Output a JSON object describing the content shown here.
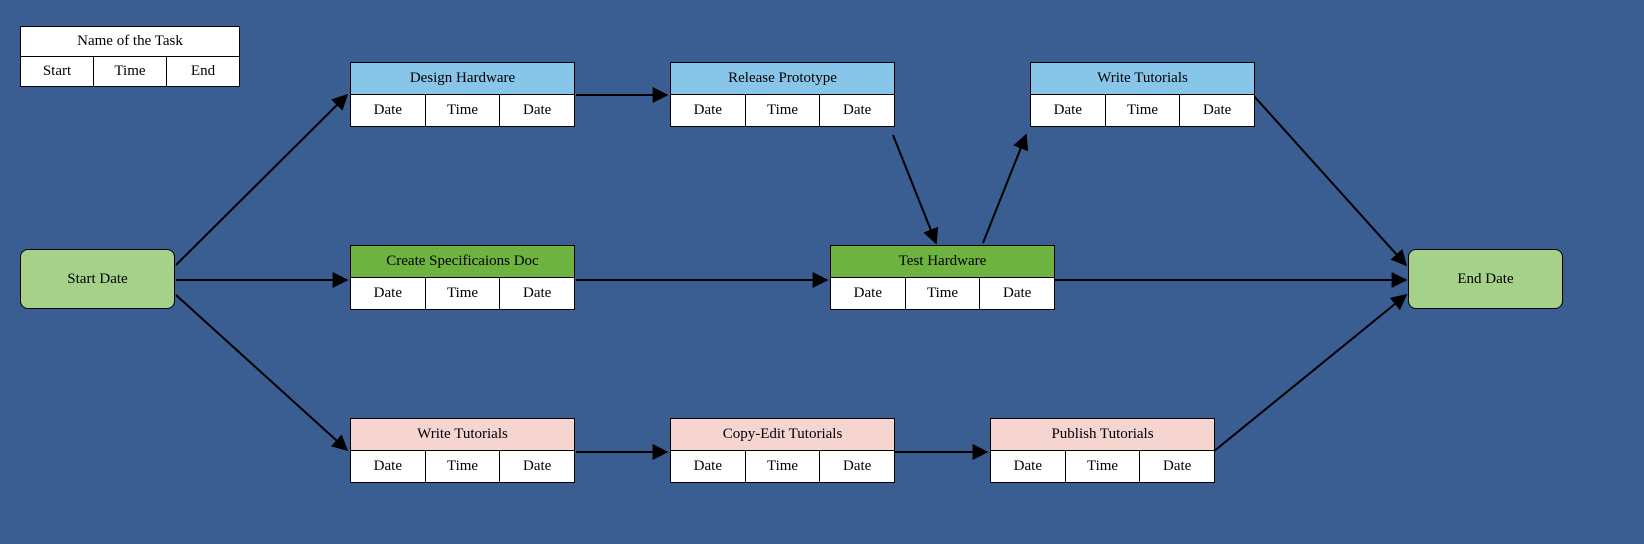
{
  "legend": {
    "title": "Name of the Task",
    "col1": "Start",
    "col2": "Time",
    "col3": "End"
  },
  "caps": {
    "start": "Start Date",
    "end": "End Date"
  },
  "cells": {
    "c1": "Date",
    "c2": "Time",
    "c3": "Date"
  },
  "tasks": {
    "design_hardware": {
      "title": "Design Hardware"
    },
    "release_prototype": {
      "title": "Release Prototype"
    },
    "write_tutorials_top": {
      "title": "Write Tutorials"
    },
    "create_spec": {
      "title": "Create Specificaions Doc"
    },
    "test_hardware": {
      "title": "Test Hardware"
    },
    "write_tutorials_bot": {
      "title": "Write Tutorials"
    },
    "copy_edit": {
      "title": "Copy-Edit Tutorials"
    },
    "publish": {
      "title": "Publish Tutorials"
    }
  }
}
